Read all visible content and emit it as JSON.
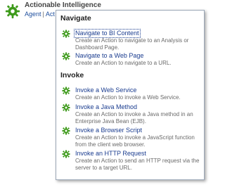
{
  "app": {
    "title": "Actionable Intelligence",
    "links": [
      "Agent",
      "Act"
    ],
    "separator": "|"
  },
  "menu": {
    "sections": [
      {
        "title": "Navigate",
        "items": [
          {
            "label": "Navigate to BI Content",
            "description": "Create an Action to navigate to an Analysis or Dashboard Page.",
            "icon": "gear-icon"
          },
          {
            "label": "Navigate to a Web Page",
            "description": "Create an Action to navigate to a URL.",
            "icon": "gear-icon"
          }
        ]
      },
      {
        "title": "Invoke",
        "items": [
          {
            "label": "Invoke a Web Service",
            "description": "Create an Action to invoke a Web Service.",
            "icon": "gear-icon"
          },
          {
            "label": "Invoke a Java Method",
            "description": "Create an Action to invoke a Java method in an Enterprise Java Bean (EJB).",
            "icon": "gear-icon"
          },
          {
            "label": "Invoke a Browser Script",
            "description": "Create an Action to invoke a JavaScript function from the client web browser.",
            "icon": "gear-icon"
          },
          {
            "label": "Invoke an HTTP Request",
            "description": "Create an Action to send an HTTP request via the server to a target URL.",
            "icon": "gear-icon"
          }
        ]
      }
    ]
  },
  "colors": {
    "link": "#1a3c8f",
    "description": "#6a6a6a",
    "gear_green": "#3d9a1a",
    "border": "#9aa6b6"
  }
}
